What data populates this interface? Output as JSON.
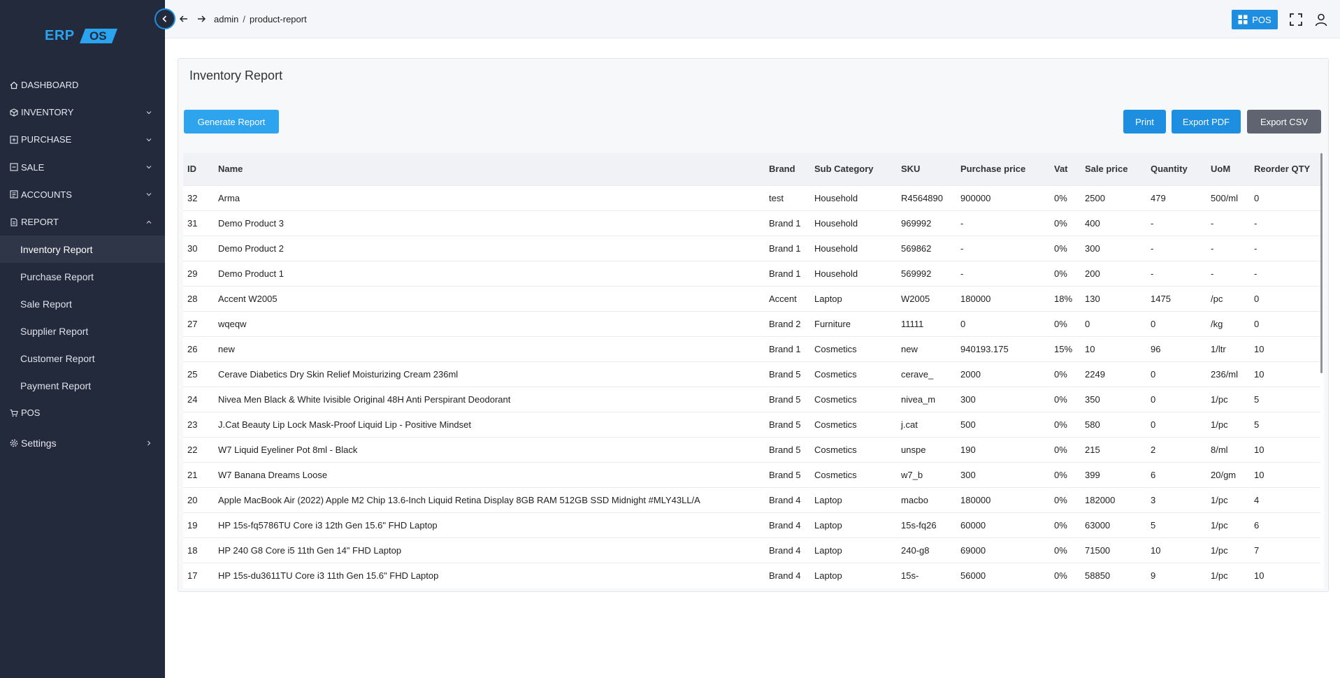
{
  "app": {
    "logo_text": "ERP",
    "logo_mark": "OS"
  },
  "sidebar": {
    "items": [
      {
        "label": "DASHBOARD",
        "icon": "home-icon",
        "has_chevron": false
      },
      {
        "label": "INVENTORY",
        "icon": "box-icon",
        "has_chevron": true
      },
      {
        "label": "PURCHASE",
        "icon": "purchase-icon",
        "has_chevron": true
      },
      {
        "label": "SALE",
        "icon": "sale-icon",
        "has_chevron": true
      },
      {
        "label": "ACCOUNTS",
        "icon": "accounts-icon",
        "has_chevron": true
      },
      {
        "label": "REPORT",
        "icon": "report-icon",
        "has_chevron": true,
        "expanded": true
      }
    ],
    "report_subitems": [
      {
        "label": "Inventory Report",
        "active": true
      },
      {
        "label": "Purchase Report"
      },
      {
        "label": "Sale Report"
      },
      {
        "label": "Supplier Report"
      },
      {
        "label": "Customer Report"
      },
      {
        "label": "Payment Report"
      }
    ],
    "pos": {
      "label": "POS",
      "icon": "cart-icon"
    },
    "settings": {
      "label": "Settings",
      "icon": "gear-icon"
    }
  },
  "topbar": {
    "breadcrumb": [
      "admin",
      "product-report"
    ],
    "breadcrumb_sep": "/",
    "pos_label": "POS"
  },
  "report": {
    "title": "Inventory Report",
    "generate_label": "Generate Report",
    "print_label": "Print",
    "export_pdf_label": "Export PDF",
    "export_csv_label": "Export CSV",
    "columns": [
      "ID",
      "Name",
      "Brand",
      "Sub Category",
      "SKU",
      "Purchase price",
      "Vat",
      "Sale price",
      "Quantity",
      "UoM",
      "Reorder QTY"
    ],
    "rows": [
      [
        "32",
        "Arma",
        "test",
        "Household",
        "R4564890",
        "900000",
        "0%",
        "2500",
        "479",
        "500/ml",
        "0"
      ],
      [
        "31",
        "Demo Product 3",
        "Brand 1",
        "Household",
        "969992",
        "-",
        "0%",
        "400",
        "-",
        "-",
        "-"
      ],
      [
        "30",
        "Demo Product 2",
        "Brand 1",
        "Household",
        "569862",
        "-",
        "0%",
        "300",
        "-",
        "-",
        "-"
      ],
      [
        "29",
        "Demo Product 1",
        "Brand 1",
        "Household",
        "569992",
        "-",
        "0%",
        "200",
        "-",
        "-",
        "-"
      ],
      [
        "28",
        "Accent W2005",
        "Accent",
        "Laptop",
        "W2005",
        "180000",
        "18%",
        "130",
        "1475",
        "/pc",
        "0"
      ],
      [
        "27",
        "wqeqw",
        "Brand 2",
        "Furniture",
        "11111",
        "0",
        "0%",
        "0",
        "0",
        "/kg",
        "0"
      ],
      [
        "26",
        "new",
        "Brand 1",
        "Cosmetics",
        "new",
        "940193.175",
        "15%",
        "10",
        "96",
        "1/ltr",
        "10"
      ],
      [
        "25",
        "Cerave Diabetics Dry Skin Relief Moisturizing Cream 236ml",
        "Brand 5",
        "Cosmetics",
        "cerave_",
        "2000",
        "0%",
        "2249",
        "0",
        "236/ml",
        "10"
      ],
      [
        "24",
        "Nivea Men Black & White Ivisible Original 48H Anti Perspirant Deodorant",
        "Brand 5",
        "Cosmetics",
        "nivea_m",
        "300",
        "0%",
        "350",
        "0",
        "1/pc",
        "5"
      ],
      [
        "23",
        "J.Cat Beauty Lip Lock Mask-Proof Liquid Lip - Positive Mindset",
        "Brand 5",
        "Cosmetics",
        "j.cat",
        "500",
        "0%",
        "580",
        "0",
        "1/pc",
        "5"
      ],
      [
        "22",
        "W7 Liquid Eyeliner Pot 8ml - Black",
        "Brand 5",
        "Cosmetics",
        "unspe",
        "190",
        "0%",
        "215",
        "2",
        "8/ml",
        "10"
      ],
      [
        "21",
        "W7 Banana Dreams Loose",
        "Brand 5",
        "Cosmetics",
        "w7_b",
        "300",
        "0%",
        "399",
        "6",
        "20/gm",
        "10"
      ],
      [
        "20",
        "Apple MacBook Air (2022) Apple M2 Chip 13.6-Inch Liquid Retina Display 8GB RAM 512GB SSD Midnight #MLY43LL/A",
        "Brand 4",
        "Laptop",
        "macbo",
        "180000",
        "0%",
        "182000",
        "3",
        "1/pc",
        "4"
      ],
      [
        "19",
        "HP 15s-fq5786TU Core i3 12th Gen 15.6\" FHD Laptop",
        "Brand 4",
        "Laptop",
        "15s-fq26",
        "60000",
        "0%",
        "63000",
        "5",
        "1/pc",
        "6"
      ],
      [
        "18",
        "HP 240 G8 Core i5 11th Gen 14\" FHD Laptop",
        "Brand 4",
        "Laptop",
        "240-g8",
        "69000",
        "0%",
        "71500",
        "10",
        "1/pc",
        "7"
      ],
      [
        "17",
        "HP 15s-du3611TU Core i3 11th Gen 15.6\" FHD Laptop",
        "Brand 4",
        "Laptop",
        "15s-",
        "56000",
        "0%",
        "58850",
        "9",
        "1/pc",
        "10"
      ]
    ]
  },
  "colors": {
    "sidebar_bg": "#232a3b",
    "accent": "#1e8fe0",
    "secondary_btn": "#5f6470"
  }
}
